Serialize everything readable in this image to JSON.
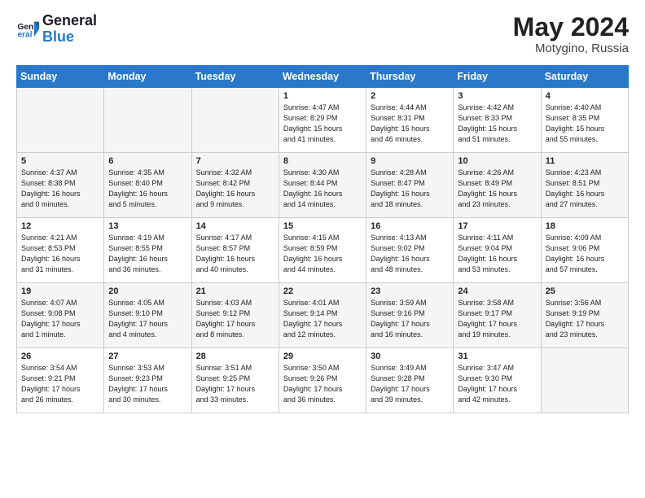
{
  "logo": {
    "line1": "General",
    "line2": "Blue"
  },
  "title": {
    "month_year": "May 2024",
    "location": "Motygino, Russia"
  },
  "weekdays": [
    "Sunday",
    "Monday",
    "Tuesday",
    "Wednesday",
    "Thursday",
    "Friday",
    "Saturday"
  ],
  "weeks": [
    [
      {
        "day": "",
        "info": ""
      },
      {
        "day": "",
        "info": ""
      },
      {
        "day": "",
        "info": ""
      },
      {
        "day": "1",
        "info": "Sunrise: 4:47 AM\nSunset: 8:29 PM\nDaylight: 15 hours\nand 41 minutes."
      },
      {
        "day": "2",
        "info": "Sunrise: 4:44 AM\nSunset: 8:31 PM\nDaylight: 15 hours\nand 46 minutes."
      },
      {
        "day": "3",
        "info": "Sunrise: 4:42 AM\nSunset: 8:33 PM\nDaylight: 15 hours\nand 51 minutes."
      },
      {
        "day": "4",
        "info": "Sunrise: 4:40 AM\nSunset: 8:35 PM\nDaylight: 15 hours\nand 55 minutes."
      }
    ],
    [
      {
        "day": "5",
        "info": "Sunrise: 4:37 AM\nSunset: 8:38 PM\nDaylight: 16 hours\nand 0 minutes."
      },
      {
        "day": "6",
        "info": "Sunrise: 4:35 AM\nSunset: 8:40 PM\nDaylight: 16 hours\nand 5 minutes."
      },
      {
        "day": "7",
        "info": "Sunrise: 4:32 AM\nSunset: 8:42 PM\nDaylight: 16 hours\nand 9 minutes."
      },
      {
        "day": "8",
        "info": "Sunrise: 4:30 AM\nSunset: 8:44 PM\nDaylight: 16 hours\nand 14 minutes."
      },
      {
        "day": "9",
        "info": "Sunrise: 4:28 AM\nSunset: 8:47 PM\nDaylight: 16 hours\nand 18 minutes."
      },
      {
        "day": "10",
        "info": "Sunrise: 4:26 AM\nSunset: 8:49 PM\nDaylight: 16 hours\nand 23 minutes."
      },
      {
        "day": "11",
        "info": "Sunrise: 4:23 AM\nSunset: 8:51 PM\nDaylight: 16 hours\nand 27 minutes."
      }
    ],
    [
      {
        "day": "12",
        "info": "Sunrise: 4:21 AM\nSunset: 8:53 PM\nDaylight: 16 hours\nand 31 minutes."
      },
      {
        "day": "13",
        "info": "Sunrise: 4:19 AM\nSunset: 8:55 PM\nDaylight: 16 hours\nand 36 minutes."
      },
      {
        "day": "14",
        "info": "Sunrise: 4:17 AM\nSunset: 8:57 PM\nDaylight: 16 hours\nand 40 minutes."
      },
      {
        "day": "15",
        "info": "Sunrise: 4:15 AM\nSunset: 8:59 PM\nDaylight: 16 hours\nand 44 minutes."
      },
      {
        "day": "16",
        "info": "Sunrise: 4:13 AM\nSunset: 9:02 PM\nDaylight: 16 hours\nand 48 minutes."
      },
      {
        "day": "17",
        "info": "Sunrise: 4:11 AM\nSunset: 9:04 PM\nDaylight: 16 hours\nand 53 minutes."
      },
      {
        "day": "18",
        "info": "Sunrise: 4:09 AM\nSunset: 9:06 PM\nDaylight: 16 hours\nand 57 minutes."
      }
    ],
    [
      {
        "day": "19",
        "info": "Sunrise: 4:07 AM\nSunset: 9:08 PM\nDaylight: 17 hours\nand 1 minute."
      },
      {
        "day": "20",
        "info": "Sunrise: 4:05 AM\nSunset: 9:10 PM\nDaylight: 17 hours\nand 4 minutes."
      },
      {
        "day": "21",
        "info": "Sunrise: 4:03 AM\nSunset: 9:12 PM\nDaylight: 17 hours\nand 8 minutes."
      },
      {
        "day": "22",
        "info": "Sunrise: 4:01 AM\nSunset: 9:14 PM\nDaylight: 17 hours\nand 12 minutes."
      },
      {
        "day": "23",
        "info": "Sunrise: 3:59 AM\nSunset: 9:16 PM\nDaylight: 17 hours\nand 16 minutes."
      },
      {
        "day": "24",
        "info": "Sunrise: 3:58 AM\nSunset: 9:17 PM\nDaylight: 17 hours\nand 19 minutes."
      },
      {
        "day": "25",
        "info": "Sunrise: 3:56 AM\nSunset: 9:19 PM\nDaylight: 17 hours\nand 23 minutes."
      }
    ],
    [
      {
        "day": "26",
        "info": "Sunrise: 3:54 AM\nSunset: 9:21 PM\nDaylight: 17 hours\nand 26 minutes."
      },
      {
        "day": "27",
        "info": "Sunrise: 3:53 AM\nSunset: 9:23 PM\nDaylight: 17 hours\nand 30 minutes."
      },
      {
        "day": "28",
        "info": "Sunrise: 3:51 AM\nSunset: 9:25 PM\nDaylight: 17 hours\nand 33 minutes."
      },
      {
        "day": "29",
        "info": "Sunrise: 3:50 AM\nSunset: 9:26 PM\nDaylight: 17 hours\nand 36 minutes."
      },
      {
        "day": "30",
        "info": "Sunrise: 3:49 AM\nSunset: 9:28 PM\nDaylight: 17 hours\nand 39 minutes."
      },
      {
        "day": "31",
        "info": "Sunrise: 3:47 AM\nSunset: 9:30 PM\nDaylight: 17 hours\nand 42 minutes."
      },
      {
        "day": "",
        "info": ""
      }
    ]
  ]
}
